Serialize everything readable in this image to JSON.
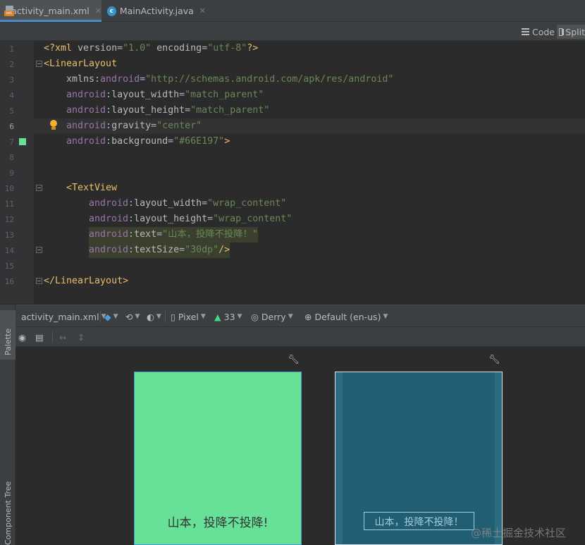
{
  "tabs": [
    {
      "label": "activity_main.xml",
      "icon": "xml-file-icon",
      "active": true
    },
    {
      "label": "MainActivity.java",
      "icon": "java-class-icon",
      "active": false
    }
  ],
  "editor_toolbar": {
    "code_label": "Code",
    "split_label": "Split"
  },
  "editor": {
    "line_numbers": [
      "1",
      "2",
      "3",
      "4",
      "5",
      "6",
      "7",
      "8",
      "9",
      "10",
      "11",
      "12",
      "13",
      "14",
      "15",
      "16"
    ],
    "current_line": 6,
    "background_swatch_color": "#66E197",
    "lines": [
      {
        "parts": [
          [
            "tag",
            "<?xml "
          ],
          [
            "attr",
            "version"
          ],
          [
            "txt",
            "="
          ],
          [
            "val",
            "\"1.0\""
          ],
          [
            "attr",
            " encoding"
          ],
          [
            "txt",
            "="
          ],
          [
            "val",
            "\"utf-8\""
          ],
          [
            "tag",
            "?>"
          ]
        ]
      },
      {
        "parts": [
          [
            "tag",
            "<LinearLayout"
          ]
        ]
      },
      {
        "parts": [
          [
            "attr",
            "xmlns"
          ],
          [
            "txt",
            ":"
          ],
          [
            "ns",
            "android"
          ],
          [
            "txt",
            "="
          ],
          [
            "val",
            "\"http://schemas.android.com/apk/res/android\""
          ]
        ]
      },
      {
        "parts": [
          [
            "ns",
            "android"
          ],
          [
            "txt",
            ":"
          ],
          [
            "attr",
            "layout_width"
          ],
          [
            "txt",
            "="
          ],
          [
            "val",
            "\"match_parent\""
          ]
        ]
      },
      {
        "parts": [
          [
            "ns",
            "android"
          ],
          [
            "txt",
            ":"
          ],
          [
            "attr",
            "layout_height"
          ],
          [
            "txt",
            "="
          ],
          [
            "val",
            "\"match_parent\""
          ]
        ]
      },
      {
        "parts": [
          [
            "ns",
            "android"
          ],
          [
            "txt",
            ":"
          ],
          [
            "attr",
            "gravity"
          ],
          [
            "txt",
            "="
          ],
          [
            "val",
            "\"center\""
          ]
        ]
      },
      {
        "parts": [
          [
            "ns",
            "android"
          ],
          [
            "txt",
            ":"
          ],
          [
            "attr",
            "background"
          ],
          [
            "txt",
            "="
          ],
          [
            "val",
            "\"#66E197\""
          ],
          [
            "tag",
            ">"
          ]
        ]
      },
      {
        "parts": []
      },
      {
        "parts": []
      },
      {
        "parts": [
          [
            "tag",
            "<TextView"
          ]
        ]
      },
      {
        "parts": [
          [
            "ns",
            "android"
          ],
          [
            "txt",
            ":"
          ],
          [
            "attr",
            "layout_width"
          ],
          [
            "txt",
            "="
          ],
          [
            "val",
            "\"wrap_content\""
          ]
        ]
      },
      {
        "parts": [
          [
            "ns",
            "android"
          ],
          [
            "txt",
            ":"
          ],
          [
            "attr",
            "layout_height"
          ],
          [
            "txt",
            "="
          ],
          [
            "val",
            "\"wrap_content\""
          ]
        ]
      },
      {
        "parts": [
          [
            "ns",
            "android"
          ],
          [
            "txt",
            ":"
          ],
          [
            "attr",
            "text"
          ],
          [
            "txt",
            "="
          ],
          [
            "val",
            "\"山本，投降不投降！\""
          ]
        ]
      },
      {
        "parts": [
          [
            "ns",
            "android"
          ],
          [
            "txt",
            ":"
          ],
          [
            "attr",
            "textSize"
          ],
          [
            "txt",
            "="
          ],
          [
            "val",
            "\"30dp\""
          ],
          [
            "tag",
            "/>"
          ]
        ]
      },
      {
        "parts": []
      },
      {
        "parts": [
          [
            "tag",
            "</LinearLayout>"
          ]
        ]
      }
    ]
  },
  "design_toolbar": {
    "file_label": "activity_main.xml",
    "device_label": "Pixel",
    "api_label": "33",
    "theme_label": "Derry",
    "locale_label": "Default (en-us)"
  },
  "side_panel": {
    "palette_label": "Palette",
    "component_tree_label": "Component Tree"
  },
  "preview": {
    "design_background": "#66E197",
    "design_text": "山本，投降不投降!",
    "blueprint_text": "山本，投降不投降！"
  },
  "watermark": "@稀土掘金技术社区"
}
